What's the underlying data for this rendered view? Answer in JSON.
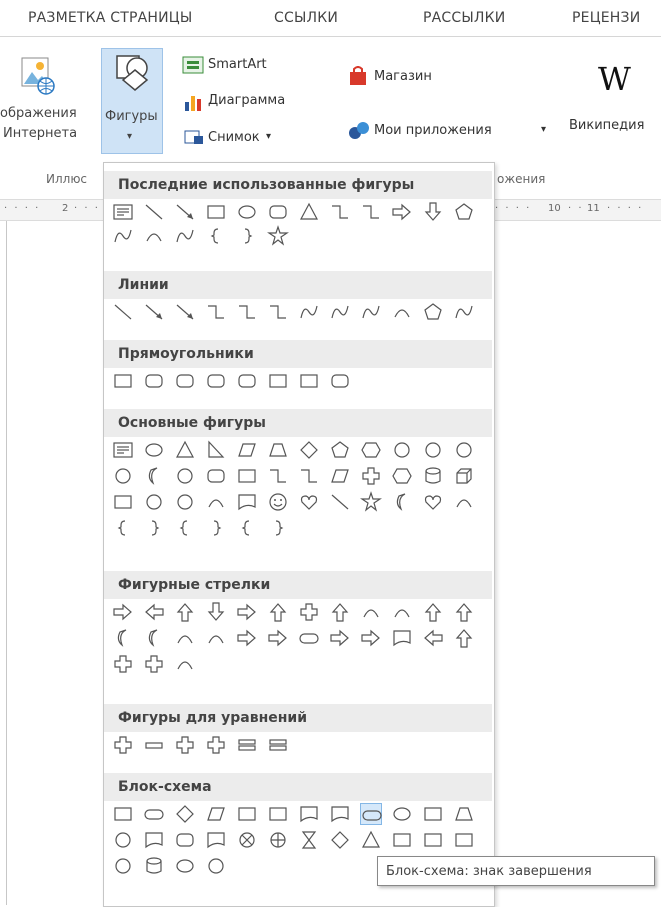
{
  "ribbon_tabs": [
    "РАЗМЕТКА СТРАНИЦЫ",
    "ССЫЛКИ",
    "РАССЫЛКИ",
    "РЕЦЕНЗИ"
  ],
  "ribbon": {
    "online_pictures_line1": "ображения",
    "online_pictures_line2": "Интернета",
    "shapes_label": "Фигуры",
    "shapes_arrow": "▾",
    "smartart_label": "SmartArt",
    "chart_label": "Диаграмма",
    "screenshot_label": "Снимок",
    "screenshot_arrow": "▾",
    "store_label": "Магазин",
    "my_apps_label": "Мои приложения",
    "my_apps_arrow": "▾",
    "wikipedia_label": "Википедия",
    "wikipedia_logo": "W",
    "group_illustrations": "Иллюс",
    "group_apps": "ожения"
  },
  "ruler": {
    "marks": [
      "2",
      "10",
      "11"
    ]
  },
  "gallery": {
    "sections": [
      "Последние использованные фигуры",
      "Линии",
      "Прямоугольники",
      "Основные фигуры",
      "Фигурные стрелки",
      "Фигуры для уравнений",
      "Блок-схема"
    ]
  },
  "tooltip": "Блок-схема: знак завершения",
  "colors": {
    "accent": "#2b579a",
    "highlight": "#cfe3f6",
    "section_bg": "#ececec"
  }
}
